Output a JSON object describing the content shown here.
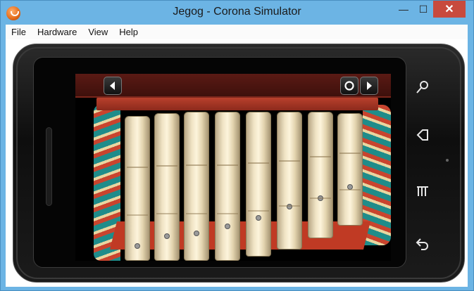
{
  "window": {
    "title": "Jegog - Corona Simulator",
    "controls": {
      "minimize": "—",
      "maximize": "☐",
      "close": "✕"
    }
  },
  "menubar": {
    "items": [
      "File",
      "Hardware",
      "View",
      "Help"
    ]
  },
  "device": {
    "side_buttons": [
      "search-icon",
      "home-icon",
      "menu-icon",
      "back-icon"
    ]
  },
  "app": {
    "toolbar": {
      "buttons": [
        "previous-arrow-icon",
        "record-icon",
        "next-arrow-icon"
      ]
    },
    "instrument": {
      "name": "Jegog",
      "keys": 8,
      "colors": {
        "frame": "#c03a24",
        "bamboo": "#efe3c4",
        "ornament": "#1f8c8a"
      }
    }
  },
  "colors": {
    "titlebar": "#6cb4e4",
    "close_button": "#c84a3d"
  }
}
